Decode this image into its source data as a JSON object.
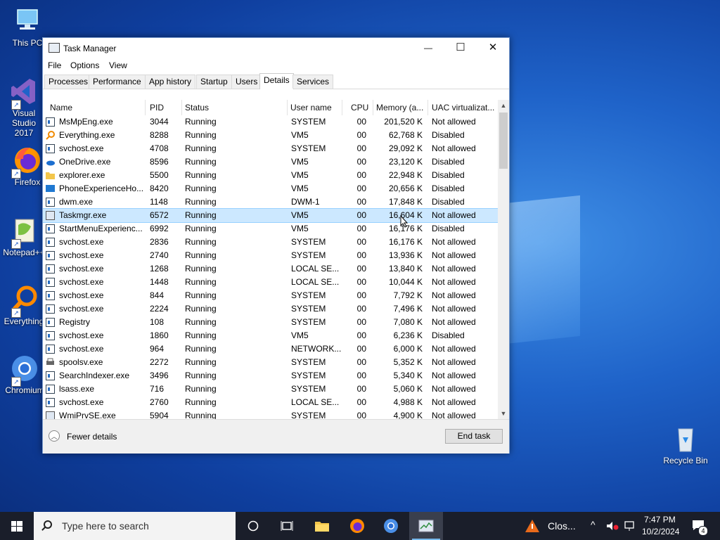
{
  "desktop": {
    "icons": [
      {
        "label": "This PC"
      },
      {
        "label": "Visual Studio 2017"
      },
      {
        "label": "Firefox"
      },
      {
        "label": "Notepad++"
      },
      {
        "label": "Everything"
      },
      {
        "label": "Chromium"
      },
      {
        "label": "Recycle Bin"
      }
    ]
  },
  "window": {
    "title": "Task Manager",
    "controls": {
      "minimize": "—",
      "maximize": "☐",
      "close": "✕"
    },
    "menu": [
      "File",
      "Options",
      "View"
    ],
    "tabs": [
      "Processes",
      "Performance",
      "App history",
      "Startup",
      "Users",
      "Details",
      "Services"
    ],
    "active_tab": "Details",
    "columns": [
      "Name",
      "PID",
      "Status",
      "User name",
      "CPU",
      "Memory (a...",
      "UAC virtualizat..."
    ],
    "rows": [
      {
        "name": "MsMpEng.exe",
        "pid": "3044",
        "status": "Running",
        "user": "SYSTEM",
        "cpu": "00",
        "mem": "201,520 K",
        "uac": "Not allowed",
        "icon": "svc"
      },
      {
        "name": "Everything.exe",
        "pid": "8288",
        "status": "Running",
        "user": "VM5",
        "cpu": "00",
        "mem": "62,768 K",
        "uac": "Disabled",
        "icon": "search"
      },
      {
        "name": "svchost.exe",
        "pid": "4708",
        "status": "Running",
        "user": "SYSTEM",
        "cpu": "00",
        "mem": "29,092 K",
        "uac": "Not allowed",
        "icon": "svc"
      },
      {
        "name": "OneDrive.exe",
        "pid": "8596",
        "status": "Running",
        "user": "VM5",
        "cpu": "00",
        "mem": "23,120 K",
        "uac": "Disabled",
        "icon": "cloud"
      },
      {
        "name": "explorer.exe",
        "pid": "5500",
        "status": "Running",
        "user": "VM5",
        "cpu": "00",
        "mem": "22,948 K",
        "uac": "Disabled",
        "icon": "folder"
      },
      {
        "name": "PhoneExperienceHo...",
        "pid": "8420",
        "status": "Running",
        "user": "VM5",
        "cpu": "00",
        "mem": "20,656 K",
        "uac": "Disabled",
        "icon": "phone"
      },
      {
        "name": "dwm.exe",
        "pid": "1148",
        "status": "Running",
        "user": "DWM-1",
        "cpu": "00",
        "mem": "17,848 K",
        "uac": "Disabled",
        "icon": "svc"
      },
      {
        "name": "Taskmgr.exe",
        "pid": "6572",
        "status": "Running",
        "user": "VM5",
        "cpu": "00",
        "mem": "16,604 K",
        "uac": "Not allowed",
        "icon": "app",
        "selected": true
      },
      {
        "name": "StartMenuExperienc...",
        "pid": "6992",
        "status": "Running",
        "user": "VM5",
        "cpu": "00",
        "mem": "16,176 K",
        "uac": "Disabled",
        "icon": "svc"
      },
      {
        "name": "svchost.exe",
        "pid": "2836",
        "status": "Running",
        "user": "SYSTEM",
        "cpu": "00",
        "mem": "16,176 K",
        "uac": "Not allowed",
        "icon": "svc"
      },
      {
        "name": "svchost.exe",
        "pid": "2740",
        "status": "Running",
        "user": "SYSTEM",
        "cpu": "00",
        "mem": "13,936 K",
        "uac": "Not allowed",
        "icon": "svc"
      },
      {
        "name": "svchost.exe",
        "pid": "1268",
        "status": "Running",
        "user": "LOCAL SE...",
        "cpu": "00",
        "mem": "13,840 K",
        "uac": "Not allowed",
        "icon": "svc"
      },
      {
        "name": "svchost.exe",
        "pid": "1448",
        "status": "Running",
        "user": "LOCAL SE...",
        "cpu": "00",
        "mem": "10,044 K",
        "uac": "Not allowed",
        "icon": "svc"
      },
      {
        "name": "svchost.exe",
        "pid": "844",
        "status": "Running",
        "user": "SYSTEM",
        "cpu": "00",
        "mem": "7,792 K",
        "uac": "Not allowed",
        "icon": "svc"
      },
      {
        "name": "svchost.exe",
        "pid": "2224",
        "status": "Running",
        "user": "SYSTEM",
        "cpu": "00",
        "mem": "7,496 K",
        "uac": "Not allowed",
        "icon": "svc"
      },
      {
        "name": "Registry",
        "pid": "108",
        "status": "Running",
        "user": "SYSTEM",
        "cpu": "00",
        "mem": "7,080 K",
        "uac": "Not allowed",
        "icon": "svc"
      },
      {
        "name": "svchost.exe",
        "pid": "1860",
        "status": "Running",
        "user": "VM5",
        "cpu": "00",
        "mem": "6,236 K",
        "uac": "Disabled",
        "icon": "svc"
      },
      {
        "name": "svchost.exe",
        "pid": "964",
        "status": "Running",
        "user": "NETWORK...",
        "cpu": "00",
        "mem": "6,000 K",
        "uac": "Not allowed",
        "icon": "svc"
      },
      {
        "name": "spoolsv.exe",
        "pid": "2272",
        "status": "Running",
        "user": "SYSTEM",
        "cpu": "00",
        "mem": "5,352 K",
        "uac": "Not allowed",
        "icon": "printer"
      },
      {
        "name": "SearchIndexer.exe",
        "pid": "3496",
        "status": "Running",
        "user": "SYSTEM",
        "cpu": "00",
        "mem": "5,340 K",
        "uac": "Not allowed",
        "icon": "svc"
      },
      {
        "name": "lsass.exe",
        "pid": "716",
        "status": "Running",
        "user": "SYSTEM",
        "cpu": "00",
        "mem": "5,060 K",
        "uac": "Not allowed",
        "icon": "svc"
      },
      {
        "name": "svchost.exe",
        "pid": "2760",
        "status": "Running",
        "user": "LOCAL SE...",
        "cpu": "00",
        "mem": "4,988 K",
        "uac": "Not allowed",
        "icon": "svc"
      },
      {
        "name": "WmiPrvSE.exe",
        "pid": "5904",
        "status": "Running",
        "user": "SYSTEM",
        "cpu": "00",
        "mem": "4,900 K",
        "uac": "Not allowed",
        "icon": "app"
      }
    ],
    "footer": {
      "fewer_details": "Fewer details",
      "end_task": "End task"
    }
  },
  "taskbar": {
    "search_placeholder": "Type here to search",
    "notification_label": "Clos...",
    "time": "7:47 PM",
    "date": "10/2/2024",
    "notification_count": "4"
  },
  "colors": {
    "selection": "#cce8ff",
    "accent": "#0078d7",
    "taskbar": "#1a1e2a"
  }
}
